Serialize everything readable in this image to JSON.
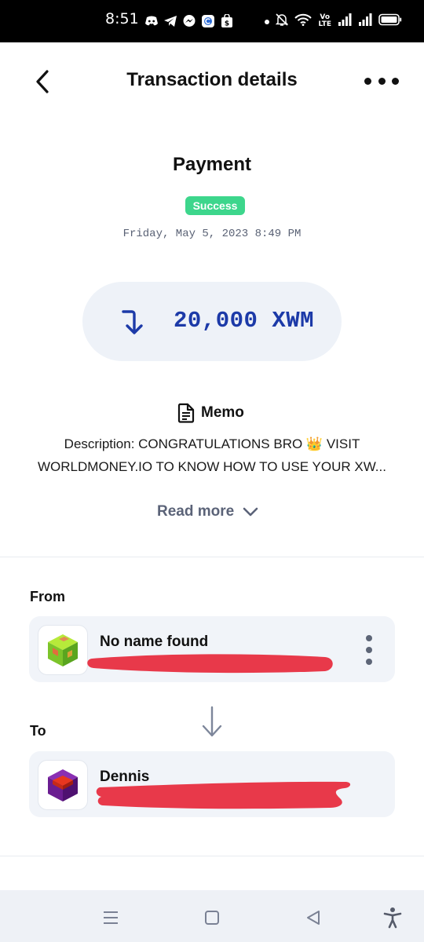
{
  "status_bar": {
    "time": "8:51",
    "notification_icons": [
      "discord-icon",
      "telegram-icon",
      "messenger-icon",
      "app-c-icon",
      "shopping-bag-icon"
    ],
    "right_icons": [
      "dot-icon",
      "mute-bell-icon",
      "wifi-icon",
      "volte-icon",
      "signal-icon",
      "signal-icon",
      "battery-icon"
    ],
    "volte_top": "Vo",
    "volte_bottom": "LTE"
  },
  "header": {
    "title": "Transaction details",
    "back_icon": "chevron-left-icon",
    "more_icon": "more-horizontal-icon"
  },
  "transaction": {
    "type": "Payment",
    "status": "Success",
    "status_color": "#3dd68c",
    "date": "Friday, May 5, 2023 8:49 PM",
    "amount": "20,000 XWM",
    "amount_color": "#1c3aa8",
    "direction_icon": "incoming-arrow-icon"
  },
  "memo": {
    "label": "Memo",
    "icon": "document-icon",
    "line1": "Description: CONGRATULATIONS BRO 👑 VISIT",
    "line2": "WORLDMONEY.IO TO KNOW HOW TO USE YOUR XW...",
    "read_more": "Read more"
  },
  "from": {
    "label": "From",
    "name": "No name found",
    "avatar_icon": "green-cube-avatar-icon",
    "menu_icon": "more-vertical-icon"
  },
  "to": {
    "label": "To",
    "name": "Dennis",
    "avatar_icon": "purple-cube-avatar-icon"
  },
  "redaction_color": "#e8394a",
  "nav_bar": {
    "buttons": [
      "menu-icon",
      "home-square-icon",
      "back-triangle-icon",
      "accessibility-icon"
    ]
  }
}
